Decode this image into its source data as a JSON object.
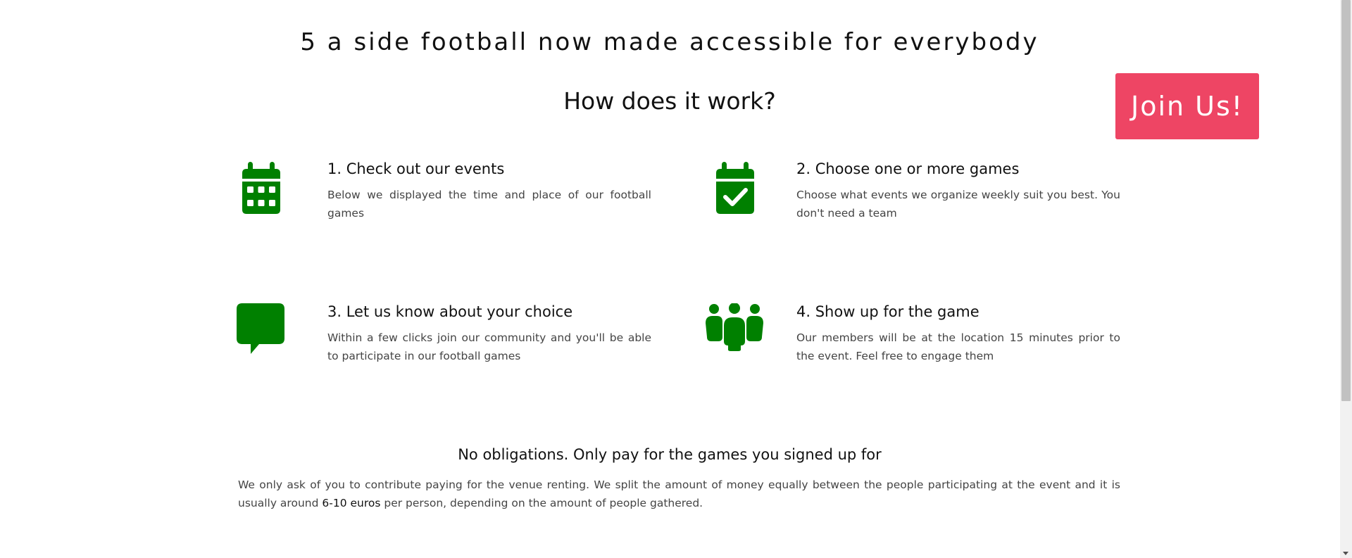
{
  "hero": {
    "headline": "5 a side football now made accessible for everybody",
    "subheading": "How does it work?"
  },
  "cta": {
    "join_label": "Join Us!",
    "color": "#ee4564"
  },
  "steps": [
    {
      "title": "1. Check out our events",
      "description": "Below we displayed the time and place of our football games",
      "icon": "calendar-icon"
    },
    {
      "title": "2. Choose one or more games",
      "description": "Choose what events we organize weekly suit you best. You don't need a team",
      "icon": "calendar-check-icon"
    },
    {
      "title": "3. Let us know about your choice",
      "description": "Within a few clicks join our community and you'll be able to participate in our football games",
      "icon": "chat-bubble-icon"
    },
    {
      "title": "4. Show up for the game",
      "description": "Our members will be at the location 15 minutes prior to the event. Feel free to engage them",
      "icon": "people-group-icon"
    }
  ],
  "pricing": {
    "heading": "No obligations. Only pay for the games you signed up for",
    "text_before": "We only ask of you to contribute paying for the venue renting. We split the amount of money equally between the people participating at the event and it is usually around ",
    "highlight": "6-10 euros",
    "text_after": " per person, depending on the amount of people gathered."
  },
  "theme": {
    "icon_color": "#008000",
    "text_color": "#111111",
    "muted_text_color": "#444444"
  }
}
